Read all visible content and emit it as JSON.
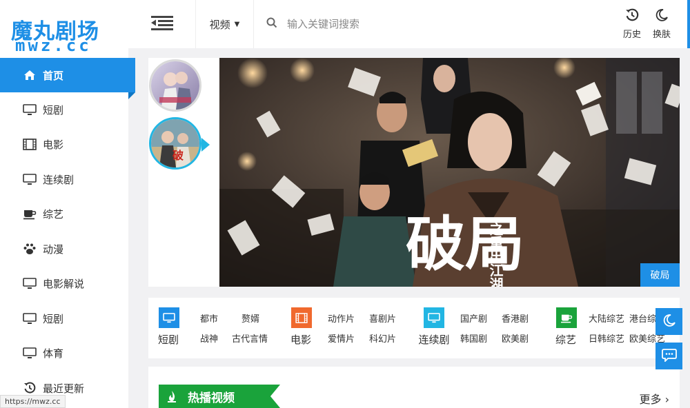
{
  "brand": {
    "title": "魔丸剧场",
    "subtitle": "mwz.cc"
  },
  "nav": [
    {
      "label": "首页",
      "icon": "home-icon",
      "active": true
    },
    {
      "label": "短剧",
      "icon": "monitor-icon"
    },
    {
      "label": "电影",
      "icon": "film-icon"
    },
    {
      "label": "连续剧",
      "icon": "monitor-icon"
    },
    {
      "label": "综艺",
      "icon": "coffee-cup-icon"
    },
    {
      "label": "动漫",
      "icon": "paw-icon"
    },
    {
      "label": "电影解说",
      "icon": "monitor-icon"
    },
    {
      "label": "短剧",
      "icon": "monitor-icon"
    },
    {
      "label": "体育",
      "icon": "monitor-icon"
    },
    {
      "label": "最近更新",
      "icon": "history-icon"
    }
  ],
  "topbar": {
    "category": "视频",
    "search_placeholder": "输入关键词搜索",
    "history_label": "历史",
    "skin_label": "换肤"
  },
  "banner": {
    "active_title": "破局",
    "poster_title": "破局",
    "poster_subtitle": "之重出江湖"
  },
  "categories": [
    {
      "title": "短剧",
      "color": "#1e8fe6",
      "icon": "monitor-icon",
      "links": [
        "都市",
        "赘婿",
        "战神",
        "古代言情"
      ]
    },
    {
      "title": "电影",
      "color": "#f0692e",
      "icon": "film-icon",
      "links": [
        "动作片",
        "喜剧片",
        "爱情片",
        "科幻片"
      ]
    },
    {
      "title": "连续剧",
      "color": "#22b6e3",
      "icon": "monitor-icon",
      "links": [
        "国产剧",
        "香港剧",
        "韩国剧",
        "欧美剧"
      ]
    },
    {
      "title": "综艺",
      "color": "#1aa33b",
      "icon": "coffee-cup-icon",
      "links": [
        "大陆综艺",
        "港台综",
        "日韩综艺",
        "欧美综艺"
      ]
    }
  ],
  "hot": {
    "title": "热播视频",
    "more": "更多"
  },
  "status_url": "https://mwz.cc"
}
